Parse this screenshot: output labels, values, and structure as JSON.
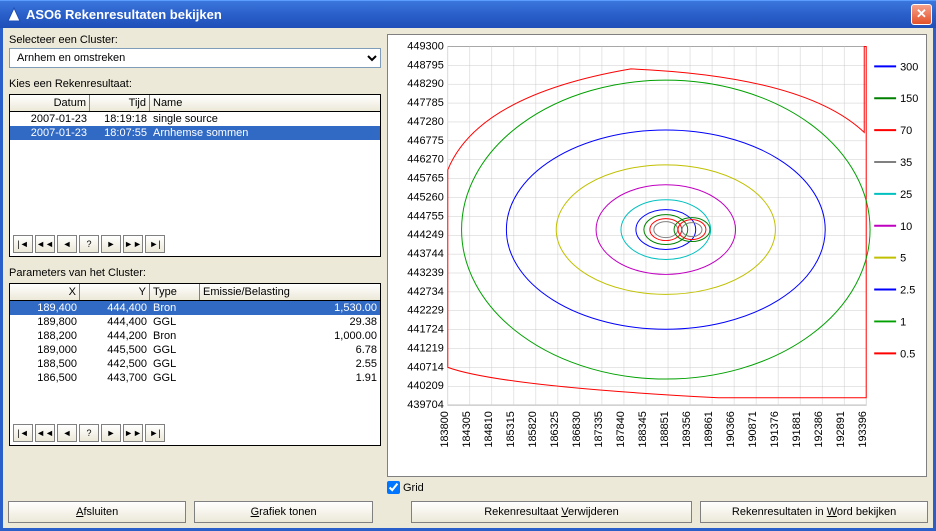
{
  "window": {
    "title": "ASO6 Rekenresultaten bekijken"
  },
  "labels": {
    "selectCluster": "Selecteer een Cluster:",
    "kiesResultaat": "Kies een Rekenresultaat:",
    "paramsCluster": "Parameters van het Cluster:",
    "gridCheckbox": "Grid"
  },
  "dropdown": {
    "selected": "Arnhem en omstreken"
  },
  "resultsGrid": {
    "headers": {
      "datum": "Datum",
      "tijd": "Tijd",
      "name": "Name"
    },
    "rows": [
      {
        "datum": "2007-01-23",
        "tijd": "18:19:18",
        "name": "single source",
        "selected": false
      },
      {
        "datum": "2007-01-23",
        "tijd": "18:07:55",
        "name": "Arnhemse sommen",
        "selected": true
      }
    ]
  },
  "paramsGrid": {
    "headers": {
      "x": "X",
      "y": "Y",
      "type": "Type",
      "em": "Emissie/Belasting"
    },
    "rows": [
      {
        "x": "189,400",
        "y": "444,400",
        "type": "Bron",
        "em": "1,530.00",
        "selected": true
      },
      {
        "x": "189,800",
        "y": "444,400",
        "type": "GGL",
        "em": "29.38",
        "selected": false
      },
      {
        "x": "188,200",
        "y": "444,200",
        "type": "Bron",
        "em": "1,000.00",
        "selected": false
      },
      {
        "x": "189,000",
        "y": "445,500",
        "type": "GGL",
        "em": "6.78",
        "selected": false
      },
      {
        "x": "188,500",
        "y": "442,500",
        "type": "GGL",
        "em": "2.55",
        "selected": false
      },
      {
        "x": "186,500",
        "y": "443,700",
        "type": "GGL",
        "em": "1.91",
        "selected": false
      }
    ]
  },
  "buttons": {
    "afsluiten": "Afsluiten",
    "grafiekTonen": "Grafiek tonen",
    "verwijderen": "Rekenresultaat Verwijderen",
    "wordBekijken": "Rekenresultaten in Word bekijken"
  },
  "nav": {
    "first": "|◄",
    "prevPage": "◄◄",
    "prev": "◄",
    "q": "?",
    "next": "►",
    "nextPage": "►►",
    "last": "►|"
  },
  "chart_data": {
    "type": "contour",
    "title": "",
    "xlabel": "",
    "ylabel": "",
    "x_ticks": [
      183800,
      184305,
      184810,
      185315,
      185820,
      186325,
      186830,
      187335,
      187840,
      188345,
      188851,
      189356,
      189861,
      190366,
      190871,
      191376,
      191881,
      192386,
      192891,
      193396
    ],
    "y_ticks": [
      439704,
      440209,
      440714,
      441219,
      441724,
      442229,
      442734,
      443239,
      443744,
      444249,
      444755,
      445260,
      445765,
      446270,
      446775,
      447280,
      447785,
      448290,
      448795,
      449300
    ],
    "xlim": [
      183800,
      193396
    ],
    "ylim": [
      439704,
      449300
    ],
    "levels": [
      {
        "value": 300,
        "color": "#0000FF"
      },
      {
        "value": 150,
        "color": "#008000"
      },
      {
        "value": 70,
        "color": "#FF0000"
      },
      {
        "value": 35,
        "color": "#808080"
      },
      {
        "value": 25,
        "color": "#00C0C0"
      },
      {
        "value": 10,
        "color": "#C000C0"
      },
      {
        "value": 5.0,
        "color": "#C0C000"
      },
      {
        "value": 2.5,
        "color": "#0000FF"
      },
      {
        "value": 1.0,
        "color": "#00A000"
      },
      {
        "value": 0.5,
        "color": "#FF0000"
      }
    ],
    "sources": [
      {
        "x": 189400,
        "y": 444400
      },
      {
        "x": 188200,
        "y": 444200
      }
    ],
    "grid": true
  }
}
